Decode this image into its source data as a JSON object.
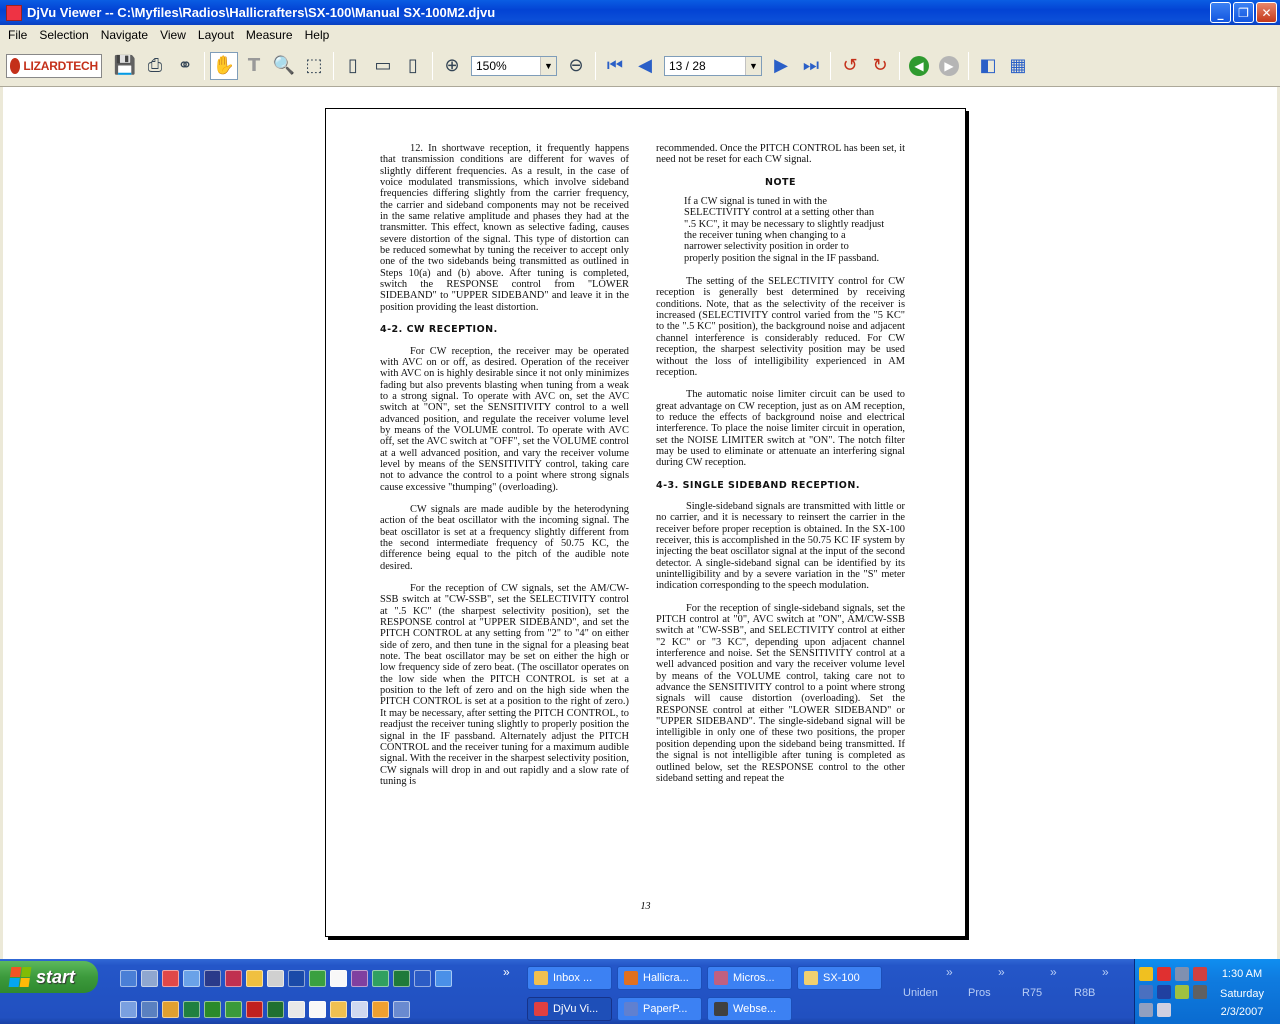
{
  "window": {
    "title": "DjVu Viewer -- C:\\Myfiles\\Radios\\Hallicrafters\\SX-100\\Manual SX-100M2.djvu",
    "minimize": "_",
    "maximize": "❐",
    "close": "✕"
  },
  "menu": [
    "File",
    "Selection",
    "Navigate",
    "View",
    "Layout",
    "Measure",
    "Help"
  ],
  "toolbar": {
    "logo": "LIZARDTECH",
    "zoom": "150%",
    "page": "13 / 28"
  },
  "document": {
    "left_column": [
      {
        "type": "p",
        "text": "12. In shortwave reception, it frequently happens that transmission conditions are different for waves of slightly different frequencies. As a result, in the case of voice modulated transmissions, which involve sideband frequencies differing slightly from the carrier frequency, the carrier and sideband components may not be received in the same relative amplitude and phases they had at the transmitter. This effect, known as selective fading, causes severe distortion of the signal. This type of distortion can be reduced somewhat by tuning the receiver to accept only one of the two sidebands being transmitted as outlined in Steps 10(a) and (b) above. After tuning is completed, switch the RESPONSE control from \"LOWER SIDEBAND\" to \"UPPER SIDEBAND\" and leave it in the position providing the least distortion."
      },
      {
        "type": "h",
        "text": "4-2.  CW RECEPTION."
      },
      {
        "type": "p",
        "text": "For CW reception, the receiver may be operated with AVC on or off, as desired. Operation of the receiver with AVC on is highly desirable since it not only minimizes fading but also prevents blasting when tuning from a weak to a strong signal. To operate with AVC on, set the AVC switch at \"ON\", set the SENSITIVITY control to a well advanced position, and regulate the receiver volume level by means of the VOLUME control. To operate with AVC off, set the AVC switch at \"OFF\", set the VOLUME control at a well advanced position, and vary the receiver volume level by means of the SENSITIVITY control, taking care not to advance the control to a point where strong signals cause excessive \"thumping\" (overloading)."
      },
      {
        "type": "p",
        "text": "CW signals are made audible by the heterodyning action of the beat oscillator with the incoming signal. The beat oscillator is set at a frequency slightly different from the second intermediate frequency of 50.75 KC, the difference being equal to the pitch of the audible note desired."
      },
      {
        "type": "p",
        "text": "For the reception of CW signals, set the AM/CW-SSB switch at \"CW-SSB\", set the SELECTIVITY control at \".5 KC\" (the sharpest selectivity position), set the RESPONSE control at \"UPPER SIDEBAND\", and set the PITCH CONTROL at any setting from \"2\" to \"4\" on either side of zero, and then tune in the signal for a pleasing beat note. The beat oscillator may be set on either the high or low frequency side of zero beat. (The oscillator operates on the low side when the PITCH CONTROL is set at a position to the left of zero and on the high side when the PITCH CONTROL is set at a position to the right of zero.) It may be necessary, after setting the PITCH CONTROL, to readjust the receiver tuning slightly to properly position the signal in the IF passband. Alternately adjust the PITCH CONTROL and the receiver tuning for a maximum audible signal. With the receiver in the sharpest selectivity position, CW signals will drop in and out rapidly and a slow rate of tuning is"
      }
    ],
    "right_column": [
      {
        "type": "p0",
        "text": "recommended. Once the PITCH CONTROL has been set, it need not be reset for each CW signal."
      },
      {
        "type": "nh",
        "text": "NOTE"
      },
      {
        "type": "nb",
        "text": "If a CW signal is tuned in with the SELECTIVITY control at a setting other than \".5 KC\", it may be necessary to slightly readjust the receiver tuning when changing to a narrower selectivity position in order to properly position the signal in the IF passband."
      },
      {
        "type": "p",
        "text": "The setting of the SELECTIVITY control for CW reception is generally best determined by receiving conditions. Note, that as the selectivity of the receiver is increased (SELECTIVITY control varied from the \"5 KC\" to the \".5 KC\" position), the background noise and adjacent channel interference is considerably reduced. For CW reception, the sharpest selectivity position may be used without the loss of intelligibility experienced in AM reception."
      },
      {
        "type": "p",
        "text": "The automatic noise limiter circuit can be used to great advantage on CW reception, just as on AM reception, to reduce the effects of background noise and electrical interference. To place the noise limiter circuit in operation, set the NOISE LIMITER switch at \"ON\". The notch filter may be used to eliminate or attenuate an interfering signal during CW reception."
      },
      {
        "type": "h",
        "text": "4-3.  SINGLE SIDEBAND RECEPTION."
      },
      {
        "type": "p",
        "text": "Single-sideband signals are transmitted with little or no carrier, and it is necessary to reinsert the carrier in the receiver before proper reception is obtained. In the SX-100 receiver, this is accomplished in the 50.75 KC IF system by injecting the beat oscillator signal at the input of the second detector. A single-sideband signal can be identified by its unintelligibility and by a severe variation in the \"S\" meter indication corresponding to the speech modulation."
      },
      {
        "type": "p",
        "text": "For the reception of single-sideband signals, set the PITCH control at \"0\", AVC switch at \"ON\", AM/CW-SSB switch at \"CW-SSB\", and SELECTIVITY control at either \"2 KC\" or \"3 KC\", depending upon adjacent channel interference and noise. Set the SENSITIVITY control at a well advanced position and vary the receiver volume level by means of the VOLUME control, taking care not to advance the SENSITIVITY control to a point where strong signals will cause distortion (overloading). Set the RESPONSE control at either \"LOWER SIDEBAND\" or \"UPPER SIDEBAND\". The single-sideband signal will be intelligible in only one of these two positions, the proper position depending upon the sideband being transmitted. If the signal is not intelligible after tuning is completed as outlined below, set the RESPONSE control to the other sideband setting and repeat the"
      }
    ],
    "page_number": "13"
  },
  "taskbar": {
    "start": "start",
    "tasks_top": [
      "Inbox ...",
      "Hallicra...",
      "Micros...",
      "SX-100"
    ],
    "tasks_bottom": [
      "DjVu Vi...",
      "PaperP...",
      "Webse..."
    ],
    "groups": [
      "Uniden",
      "Pros",
      "R75",
      "R8B"
    ],
    "chevron": "»",
    "clock": {
      "time": "1:30 AM",
      "day": "Saturday",
      "date": "2/3/2007"
    }
  },
  "colors": {
    "titlebar": "#0a5de3",
    "taskbar": "#2456c8",
    "start": "#3c9a3c"
  }
}
